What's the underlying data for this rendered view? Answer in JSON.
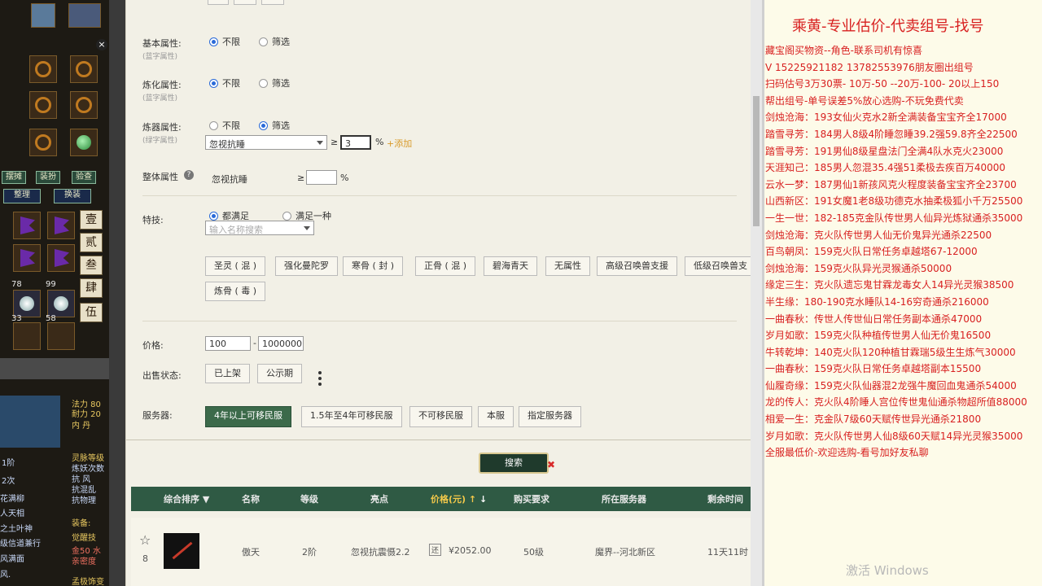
{
  "game_panel": {
    "buttons": [
      "摆摊",
      "装扮",
      "验查",
      "整理",
      "换装"
    ],
    "side_chars": [
      "壹",
      "贰",
      "叁",
      "肆",
      "伍"
    ],
    "counts": [
      "78",
      "99",
      "33",
      "58"
    ],
    "stats": [
      "法力 80",
      "耐力 20",
      "内 丹"
    ],
    "skills_title": "灵脉等级",
    "left_labels": [
      "1阶",
      "2次"
    ],
    "lines": [
      "炼妖次数",
      "抗 风",
      "抗混乱",
      "抗物理"
    ],
    "list": [
      "花满柳",
      "人天相",
      "之土叶神",
      "级信道兼行",
      "风满面",
      "风."
    ],
    "equip_label": "装备:",
    "awaken_label": "觉醒技",
    "equip_stats": [
      "金50 水",
      "亲密度"
    ],
    "bottom": "孟极饰变"
  },
  "filters": {
    "basic": {
      "label": "基本属性:",
      "sub": "(蓝字属性)",
      "opt1": "不限",
      "opt2": "筛选"
    },
    "refine": {
      "label": "炼化属性:",
      "sub": "(蓝字属性)",
      "opt1": "不限",
      "opt2": "筛选"
    },
    "bone": {
      "label": "炼器属性:",
      "sub": "(绿字属性)",
      "opt1": "不限",
      "opt2": "筛选",
      "select_value": "忽视抗睡",
      "ge": "≥",
      "input_value": "3",
      "unit": "%",
      "add_link": "+添加"
    },
    "overall": {
      "label": "整体属性",
      "attr": "忽视抗睡",
      "ge": "≥",
      "unit": "%"
    },
    "skill": {
      "label": "特技:",
      "opt1": "都满足",
      "opt2": "满足一种",
      "placeholder": "输入名称搜索"
    },
    "skill_tags": [
      "圣灵 ( 混 )",
      "强化曼陀罗",
      "寒骨 ( 封 )",
      "正骨 ( 混 )",
      "碧海青天",
      "无属性",
      "高级召唤兽支援",
      "低级召唤兽支",
      "炼骨 ( 毒 )"
    ],
    "price": {
      "label": "价格:",
      "min": "100",
      "dash": "-",
      "max": "1000000"
    },
    "sale": {
      "label": "出售状态:",
      "opt1": "已上架",
      "opt2": "公示期"
    },
    "server": {
      "label": "服务器:",
      "opts": [
        "4年以上可移民服",
        "1.5年至4年可移民服",
        "不可移民服",
        "本服",
        "指定服务器"
      ]
    },
    "search_label": "搜索"
  },
  "table": {
    "headers": [
      "综合排序",
      "名称",
      "等级",
      "亮点",
      "价格(元)",
      "购买要求",
      "所在服务器",
      "剩余时间"
    ],
    "row": {
      "fav_count": "8",
      "name": "傲天",
      "level": "2阶",
      "highlight": "忽视抗震慑2.2",
      "price": "¥2052.00",
      "price_tag": "还",
      "req": "50级",
      "server": "魔界--河北新区",
      "time": "11天11时"
    }
  },
  "right_panel": {
    "title": "乘黄-专业估价-代卖组号-找号",
    "lines": [
      "藏宝阁买物资--角色-联系司机有惊喜",
      "V 15225921182  13782553976朋友圈出组号",
      "扫码估号3万30票- 10万-50 --20万-100- 20以上150",
      "帮出组号-单号误差5%放心选购-不玩免费代卖",
      "剑烛沧海：193女仙火克水2新全满装备宝宝齐全17000",
      "踏雪寻芳：184男人8级4阶睡忽睡39.2强59.8齐全22500",
      "踏雪寻芳：191男仙8级星盘法门全满4队水克火23000",
      "天涯知己：185男人忽混35.4强51柔极去疾百万40000",
      "云水一梦：187男仙1新孩风克火程度装备宝宝齐全23700",
      "山西新区：191女魔1老8级功德克水抽柔极狐小千万25500",
      "一生一世：182-185克金队传世男人仙异光炼狱通杀35000",
      "剑烛沧海：克火队传世男人仙无价鬼异光通杀22500",
      "百鸟朝凤：159克火队日常任务卓越塔67-12000",
      "剑烛沧海：159克火队异光灵猴通杀50000",
      "缘定三生：克火队遗忘鬼甘霖龙毒女人14异光灵猴38500",
      "半生缘：180-190克水睡队14-16穷奇通杀216000",
      "一曲春秋：传世人传世仙日常任务副本通杀47000",
      "岁月如歌：159克火队种植传世男人仙无价鬼16500",
      "牛转乾坤：140克火队120种植甘霖瑞5级生生炼气30000",
      "一曲春秋：159克火队日常任务卓越塔副本15500",
      "仙履奇缘：159克火队仙器混2龙强牛魔回血鬼通杀54000",
      "龙的传人：克火队4阶睡人宫位传世鬼仙通杀物超所值88000",
      "相爱一生：克金队7级60天赋传世异光通杀21800",
      "岁月如歌：克火队传世男人仙8级60天赋14异光灵猴35000",
      "全服最低价-欢迎选购-看号加好友私聊"
    ],
    "watermark": "激活 Windows"
  }
}
